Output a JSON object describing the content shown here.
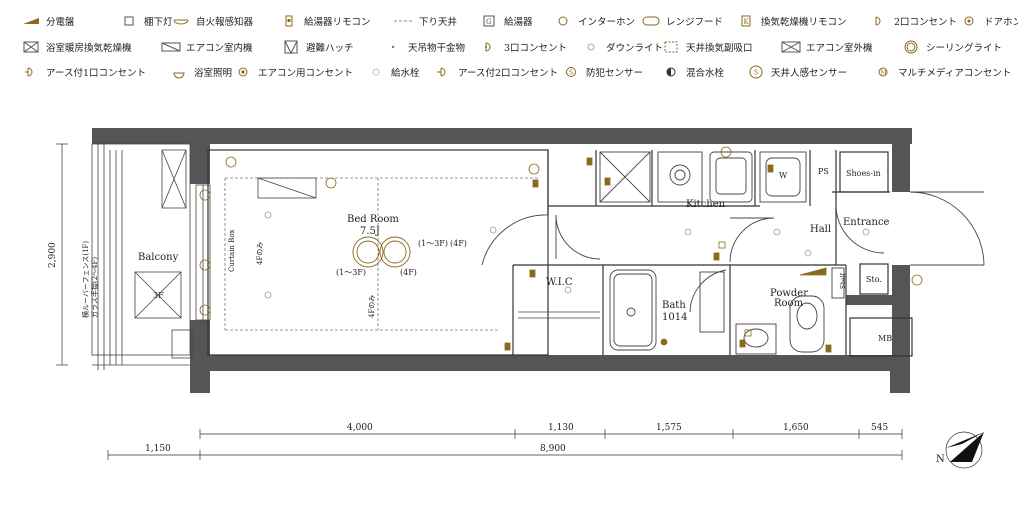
{
  "legend": [
    {
      "icon": "distribution-board-icon",
      "label": "分電盤"
    },
    {
      "icon": "under-cabinet-light-icon",
      "label": "棚下灯"
    },
    {
      "icon": "fire-alarm-sensor-icon",
      "label": "自火報感知器"
    },
    {
      "icon": "water-heater-remote-icon",
      "label": "給湯器リモコン"
    },
    {
      "icon": "dropped-ceiling-icon",
      "label": "下り天井"
    },
    {
      "icon": "water-heater-icon",
      "label": "給湯器"
    },
    {
      "icon": "intercom-icon",
      "label": "インターホン"
    },
    {
      "icon": "range-hood-icon",
      "label": "レンジフード"
    },
    {
      "icon": "dryer-remote-icon",
      "label": "換気乾燥機リモコン"
    },
    {
      "icon": "double-outlet-icon",
      "label": "2口コンセント"
    },
    {
      "icon": "door-phone-icon",
      "label": "ドアホン"
    },
    {
      "icon": "bathroom-dryer-icon",
      "label": "浴室暖房換気乾燥機"
    },
    {
      "icon": "ac-indoor-unit-icon",
      "label": "エアコン室内機"
    },
    {
      "icon": "escape-hatch-icon",
      "label": "避難ハッチ"
    },
    {
      "icon": "clothes-hanger-icon",
      "label": "天吊物干金物"
    },
    {
      "icon": "triple-outlet-icon",
      "label": "3口コンセント"
    },
    {
      "icon": "downlight-icon",
      "label": "ダウンライト"
    },
    {
      "icon": "ceiling-vent-icon",
      "label": "天井換気副吸口"
    },
    {
      "icon": "ac-outdoor-unit-icon",
      "label": "エアコン室外機"
    },
    {
      "icon": "ceiling-light-icon",
      "label": "シーリングライト"
    },
    {
      "icon": "grounded-single-outlet-icon",
      "label": "アース付1口コンセント"
    },
    {
      "icon": "bathroom-light-icon",
      "label": "浴室照明"
    },
    {
      "icon": "ac-outlet-icon",
      "label": "エアコン用コンセント"
    },
    {
      "icon": "water-faucet-icon",
      "label": "給水栓"
    },
    {
      "icon": "grounded-double-outlet-icon",
      "label": "アース付2口コンセント"
    },
    {
      "icon": "security-sensor-icon",
      "label": "防犯センサー"
    },
    {
      "icon": "mixing-faucet-icon",
      "label": "混合水栓"
    },
    {
      "icon": "motion-sensor-icon",
      "label": "天井人感センサー"
    },
    {
      "icon": "multimedia-outlet-icon",
      "label": "マルチメディアコンセント"
    }
  ],
  "rooms": {
    "balcony": "Balcony",
    "bedroom": "Bed Room",
    "bedroom_size": "7.5J",
    "wic": "W.I.C",
    "kitchen": "Kitchen",
    "bath": "Bath",
    "bath_size": "1014",
    "powder": "Powder",
    "powder2": "Room",
    "hall": "Hall",
    "entrance": "Entrance",
    "shoes": "Shoes-in",
    "storage": "Sto.",
    "shelf": "Shelf",
    "ps": "PS",
    "mb": "MB",
    "washer": "W",
    "ac_unit": "3F",
    "curtain_box": "Curtain Box",
    "fence_note_1": "横ルーバーフェンス(1F)",
    "fence_note_2": "ガラス手摺(2〜4F)",
    "only_4f_a": "4Fのみ",
    "only_4f_b": "4Fのみ",
    "ceiling_1_3f": "(1〜3F)",
    "ceiling_4f": "(4F)",
    "ceiling_1_3f_b": "(1〜3F)",
    "ceiling_4f_b": "(4F)"
  },
  "dimensions": {
    "height": "2,900",
    "seg1": "4,000",
    "seg2": "1,130",
    "seg3": "1,575",
    "seg4": "1,650",
    "seg5": "545",
    "balcony_depth": "1,150",
    "total": "8,900"
  },
  "compass": {
    "north": "N"
  },
  "colors": {
    "wall": "#555555",
    "gold": "#8b6a1e",
    "line": "#333333"
  }
}
